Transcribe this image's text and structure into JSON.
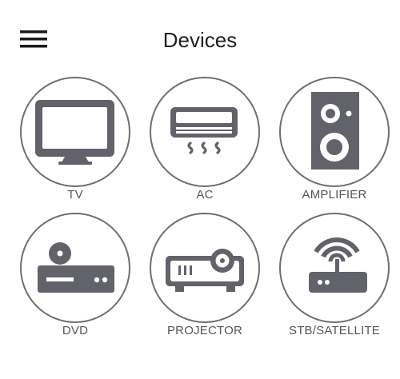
{
  "header": {
    "menu_icon": "hamburger-menu-icon",
    "title": "Devices"
  },
  "theme": {
    "icon_color": "#62626a",
    "circle_border": "#6f6f72",
    "label_color": "#555558"
  },
  "devices": [
    {
      "label": "TV",
      "icon": "tv-icon"
    },
    {
      "label": "AC",
      "icon": "air-conditioner-icon"
    },
    {
      "label": "AMPLIFIER",
      "icon": "speaker-icon"
    },
    {
      "label": "DVD",
      "icon": "dvd-player-icon"
    },
    {
      "label": "PROJECTOR",
      "icon": "projector-icon"
    },
    {
      "label": "STB/SATELLITE",
      "icon": "router-icon"
    }
  ]
}
